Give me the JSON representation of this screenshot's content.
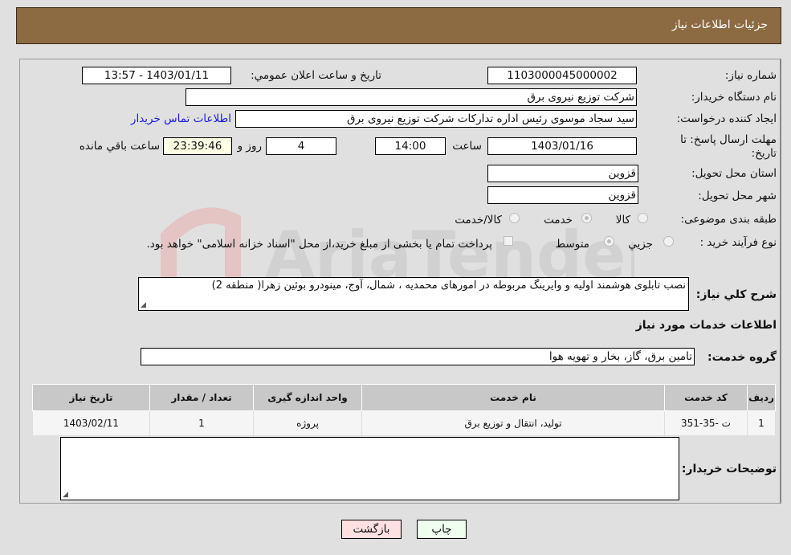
{
  "header": {
    "title": "جزئیات اطلاعات نیاز"
  },
  "form": {
    "need_number": {
      "label": "شماره نیاز:",
      "value": "1103000045000002"
    },
    "announce_datetime": {
      "label": "تاريخ و ساعت اعلان عمومي:",
      "value": "1403/01/11 - 13:57"
    },
    "buyer_org": {
      "label": "نام دستگاه خريدار:",
      "value": "شرکت توزیع نیروی برق"
    },
    "requester": {
      "label": "ايجاد کننده درخواست:",
      "value": "سید سجاد موسوی رئیس اداره تدارکات شرکت توزیع نیروی برق",
      "contact_link": "اطلاعات تماس خريدار"
    },
    "deadline": {
      "label": "مهلت ارسال پاسخ: تا تاريخ:",
      "date": "1403/01/16",
      "time_label": "ساعت",
      "time": "14:00",
      "days": "4",
      "days_label": "روز و",
      "remaining": "23:39:46",
      "remaining_label": "ساعت باقي مانده"
    },
    "province": {
      "label": "استان محل تحويل:",
      "value": "قزوین"
    },
    "city": {
      "label": "شهر محل تحويل:",
      "value": "قزوین"
    },
    "category": {
      "label": "طبقه بندی موضوعی:",
      "options": [
        "کالا",
        "خدمت",
        "کالا/خدمت"
      ],
      "selected": "خدمت"
    },
    "process": {
      "label": "نوع فرآيند خريد :",
      "options": [
        "جزيي",
        "متوسط"
      ],
      "selected": "متوسط",
      "treasury_note": "پرداخت تمام يا بخشی از مبلغ خريد،از محل \"اسناد خزانه اسلامی\" خواهد بود."
    },
    "description": {
      "label": "شرح کلي نياز:",
      "value": "نصب تابلوی هوشمند اولیه و وایرینگ مربوطه در امورهای محمدیه ، شمال، آوج، مینودرو بوئین زهرا( منطقه 2)"
    },
    "services_title": "اطلاعات خدمات مورد نياز",
    "service_group": {
      "label": "گروه خدمت:",
      "value": "تامین برق، گاز، بخار و تهویه هوا"
    },
    "buyer_notes": {
      "label": "توضيحات خريدار:",
      "value": ""
    }
  },
  "table": {
    "headers": [
      "رديف",
      "کد خدمت",
      "نام خدمت",
      "واحد اندازه گيری",
      "تعداد / مقدار",
      "تاريخ نياز"
    ],
    "rows": [
      [
        "1",
        "ت -35-351",
        "تولید، انتقال و توزیع برق",
        "پروژه",
        "1",
        "1403/02/11"
      ]
    ]
  },
  "buttons": {
    "print": "چاپ",
    "back": "بازگشت"
  },
  "watermark": "AriaTender.neT"
}
